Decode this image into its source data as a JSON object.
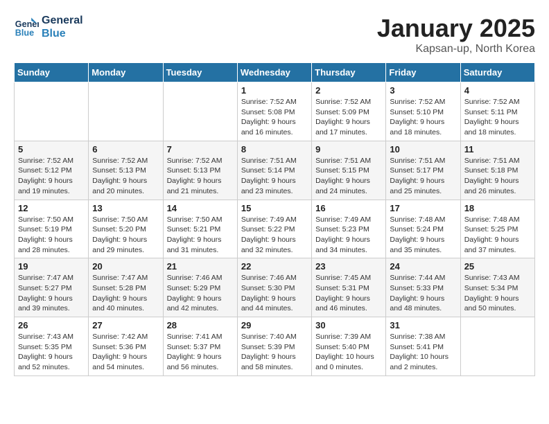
{
  "logo": {
    "line1": "General",
    "line2": "Blue"
  },
  "title": "January 2025",
  "location": "Kapsan-up, North Korea",
  "weekdays": [
    "Sunday",
    "Monday",
    "Tuesday",
    "Wednesday",
    "Thursday",
    "Friday",
    "Saturday"
  ],
  "weeks": [
    [
      {
        "day": "",
        "info": ""
      },
      {
        "day": "",
        "info": ""
      },
      {
        "day": "",
        "info": ""
      },
      {
        "day": "1",
        "info": "Sunrise: 7:52 AM\nSunset: 5:08 PM\nDaylight: 9 hours\nand 16 minutes."
      },
      {
        "day": "2",
        "info": "Sunrise: 7:52 AM\nSunset: 5:09 PM\nDaylight: 9 hours\nand 17 minutes."
      },
      {
        "day": "3",
        "info": "Sunrise: 7:52 AM\nSunset: 5:10 PM\nDaylight: 9 hours\nand 18 minutes."
      },
      {
        "day": "4",
        "info": "Sunrise: 7:52 AM\nSunset: 5:11 PM\nDaylight: 9 hours\nand 18 minutes."
      }
    ],
    [
      {
        "day": "5",
        "info": "Sunrise: 7:52 AM\nSunset: 5:12 PM\nDaylight: 9 hours\nand 19 minutes."
      },
      {
        "day": "6",
        "info": "Sunrise: 7:52 AM\nSunset: 5:13 PM\nDaylight: 9 hours\nand 20 minutes."
      },
      {
        "day": "7",
        "info": "Sunrise: 7:52 AM\nSunset: 5:13 PM\nDaylight: 9 hours\nand 21 minutes."
      },
      {
        "day": "8",
        "info": "Sunrise: 7:51 AM\nSunset: 5:14 PM\nDaylight: 9 hours\nand 23 minutes."
      },
      {
        "day": "9",
        "info": "Sunrise: 7:51 AM\nSunset: 5:15 PM\nDaylight: 9 hours\nand 24 minutes."
      },
      {
        "day": "10",
        "info": "Sunrise: 7:51 AM\nSunset: 5:17 PM\nDaylight: 9 hours\nand 25 minutes."
      },
      {
        "day": "11",
        "info": "Sunrise: 7:51 AM\nSunset: 5:18 PM\nDaylight: 9 hours\nand 26 minutes."
      }
    ],
    [
      {
        "day": "12",
        "info": "Sunrise: 7:50 AM\nSunset: 5:19 PM\nDaylight: 9 hours\nand 28 minutes."
      },
      {
        "day": "13",
        "info": "Sunrise: 7:50 AM\nSunset: 5:20 PM\nDaylight: 9 hours\nand 29 minutes."
      },
      {
        "day": "14",
        "info": "Sunrise: 7:50 AM\nSunset: 5:21 PM\nDaylight: 9 hours\nand 31 minutes."
      },
      {
        "day": "15",
        "info": "Sunrise: 7:49 AM\nSunset: 5:22 PM\nDaylight: 9 hours\nand 32 minutes."
      },
      {
        "day": "16",
        "info": "Sunrise: 7:49 AM\nSunset: 5:23 PM\nDaylight: 9 hours\nand 34 minutes."
      },
      {
        "day": "17",
        "info": "Sunrise: 7:48 AM\nSunset: 5:24 PM\nDaylight: 9 hours\nand 35 minutes."
      },
      {
        "day": "18",
        "info": "Sunrise: 7:48 AM\nSunset: 5:25 PM\nDaylight: 9 hours\nand 37 minutes."
      }
    ],
    [
      {
        "day": "19",
        "info": "Sunrise: 7:47 AM\nSunset: 5:27 PM\nDaylight: 9 hours\nand 39 minutes."
      },
      {
        "day": "20",
        "info": "Sunrise: 7:47 AM\nSunset: 5:28 PM\nDaylight: 9 hours\nand 40 minutes."
      },
      {
        "day": "21",
        "info": "Sunrise: 7:46 AM\nSunset: 5:29 PM\nDaylight: 9 hours\nand 42 minutes."
      },
      {
        "day": "22",
        "info": "Sunrise: 7:46 AM\nSunset: 5:30 PM\nDaylight: 9 hours\nand 44 minutes."
      },
      {
        "day": "23",
        "info": "Sunrise: 7:45 AM\nSunset: 5:31 PM\nDaylight: 9 hours\nand 46 minutes."
      },
      {
        "day": "24",
        "info": "Sunrise: 7:44 AM\nSunset: 5:33 PM\nDaylight: 9 hours\nand 48 minutes."
      },
      {
        "day": "25",
        "info": "Sunrise: 7:43 AM\nSunset: 5:34 PM\nDaylight: 9 hours\nand 50 minutes."
      }
    ],
    [
      {
        "day": "26",
        "info": "Sunrise: 7:43 AM\nSunset: 5:35 PM\nDaylight: 9 hours\nand 52 minutes."
      },
      {
        "day": "27",
        "info": "Sunrise: 7:42 AM\nSunset: 5:36 PM\nDaylight: 9 hours\nand 54 minutes."
      },
      {
        "day": "28",
        "info": "Sunrise: 7:41 AM\nSunset: 5:37 PM\nDaylight: 9 hours\nand 56 minutes."
      },
      {
        "day": "29",
        "info": "Sunrise: 7:40 AM\nSunset: 5:39 PM\nDaylight: 9 hours\nand 58 minutes."
      },
      {
        "day": "30",
        "info": "Sunrise: 7:39 AM\nSunset: 5:40 PM\nDaylight: 10 hours\nand 0 minutes."
      },
      {
        "day": "31",
        "info": "Sunrise: 7:38 AM\nSunset: 5:41 PM\nDaylight: 10 hours\nand 2 minutes."
      },
      {
        "day": "",
        "info": ""
      }
    ]
  ]
}
